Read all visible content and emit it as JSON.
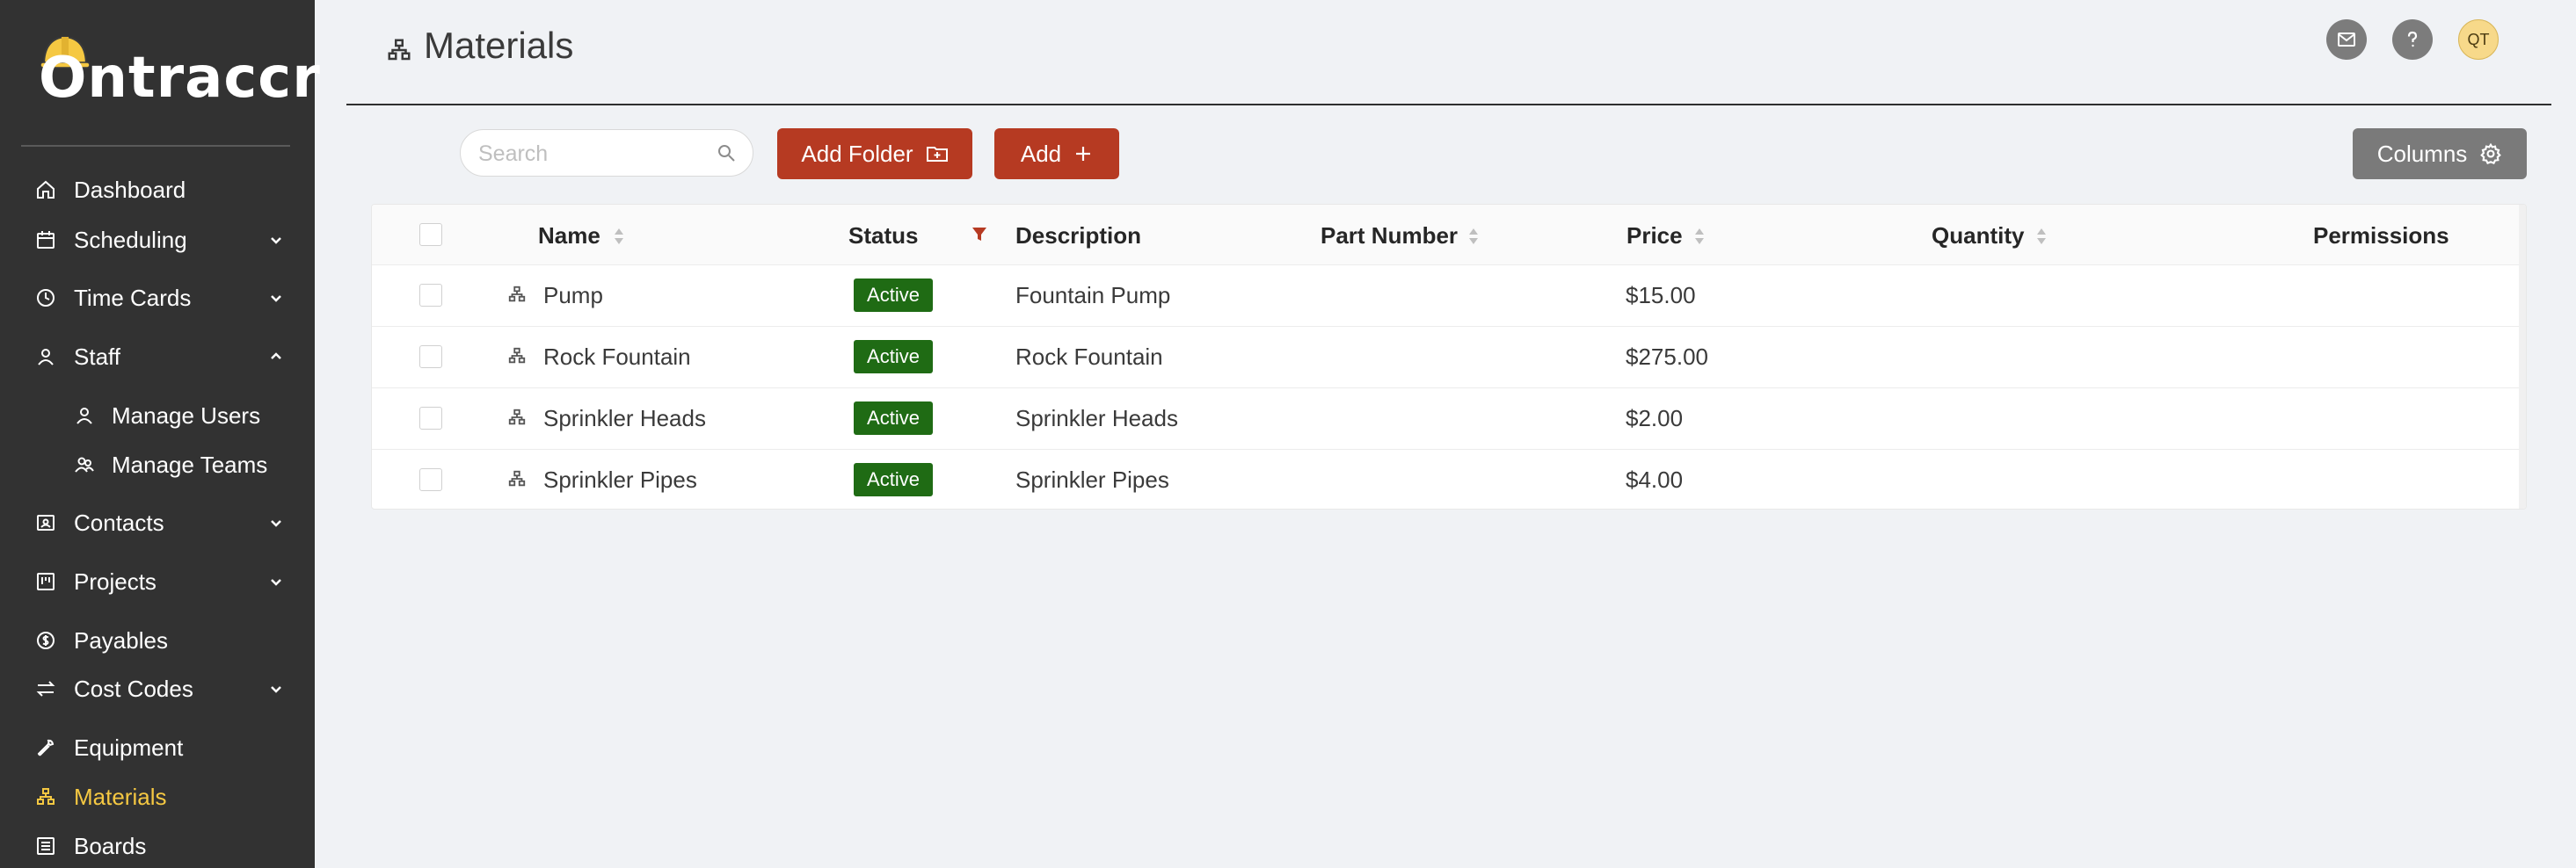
{
  "app": {
    "logo_text": "Ontraccr"
  },
  "sidebar": {
    "items": [
      {
        "label": "Dashboard",
        "icon": "home-icon"
      },
      {
        "label": "Scheduling",
        "icon": "calendar-icon"
      },
      {
        "label": "Time Cards",
        "icon": "clock-icon"
      },
      {
        "label": "Staff",
        "icon": "user-icon"
      },
      {
        "label": "Manage Users",
        "icon": "user-icon"
      },
      {
        "label": "Manage Teams",
        "icon": "team-icon"
      },
      {
        "label": "Contacts",
        "icon": "contacts-icon"
      },
      {
        "label": "Projects",
        "icon": "projects-icon"
      },
      {
        "label": "Payables",
        "icon": "dollar-icon"
      },
      {
        "label": "Cost Codes",
        "icon": "swap-icon"
      },
      {
        "label": "Equipment",
        "icon": "wrench-icon"
      },
      {
        "label": "Materials",
        "icon": "materials-icon"
      },
      {
        "label": "Boards",
        "icon": "boards-icon"
      }
    ],
    "active": "Materials"
  },
  "header": {
    "title": "Materials",
    "avatar_initials": "QT",
    "icons": [
      "mail-icon",
      "help-icon"
    ]
  },
  "toolbar": {
    "search_placeholder": "Search",
    "add_folder_label": "Add Folder",
    "add_label": "Add",
    "columns_label": "Columns"
  },
  "table": {
    "columns": [
      "Name",
      "Status",
      "Description",
      "Part Number",
      "Price",
      "Quantity",
      "Permissions"
    ],
    "rows": [
      {
        "name": "Pump",
        "status": "Active",
        "description": "Fountain Pump",
        "part_number": "",
        "price": "$15.00",
        "quantity": "",
        "permissions": ""
      },
      {
        "name": "Rock Fountain",
        "status": "Active",
        "description": "Rock Fountain",
        "part_number": "",
        "price": "$275.00",
        "quantity": "",
        "permissions": ""
      },
      {
        "name": "Sprinkler Heads",
        "status": "Active",
        "description": "Sprinkler Heads",
        "part_number": "",
        "price": "$2.00",
        "quantity": "",
        "permissions": ""
      },
      {
        "name": "Sprinkler Pipes",
        "status": "Active",
        "description": "Sprinkler Pipes",
        "part_number": "",
        "price": "$4.00",
        "quantity": "",
        "permissions": ""
      }
    ]
  },
  "colors": {
    "sidebar_bg": "#323232",
    "accent_active": "#f5c842",
    "primary_button": "#b63a22",
    "status_active": "#1f6b14",
    "secondary_button": "#7a7a7a"
  }
}
